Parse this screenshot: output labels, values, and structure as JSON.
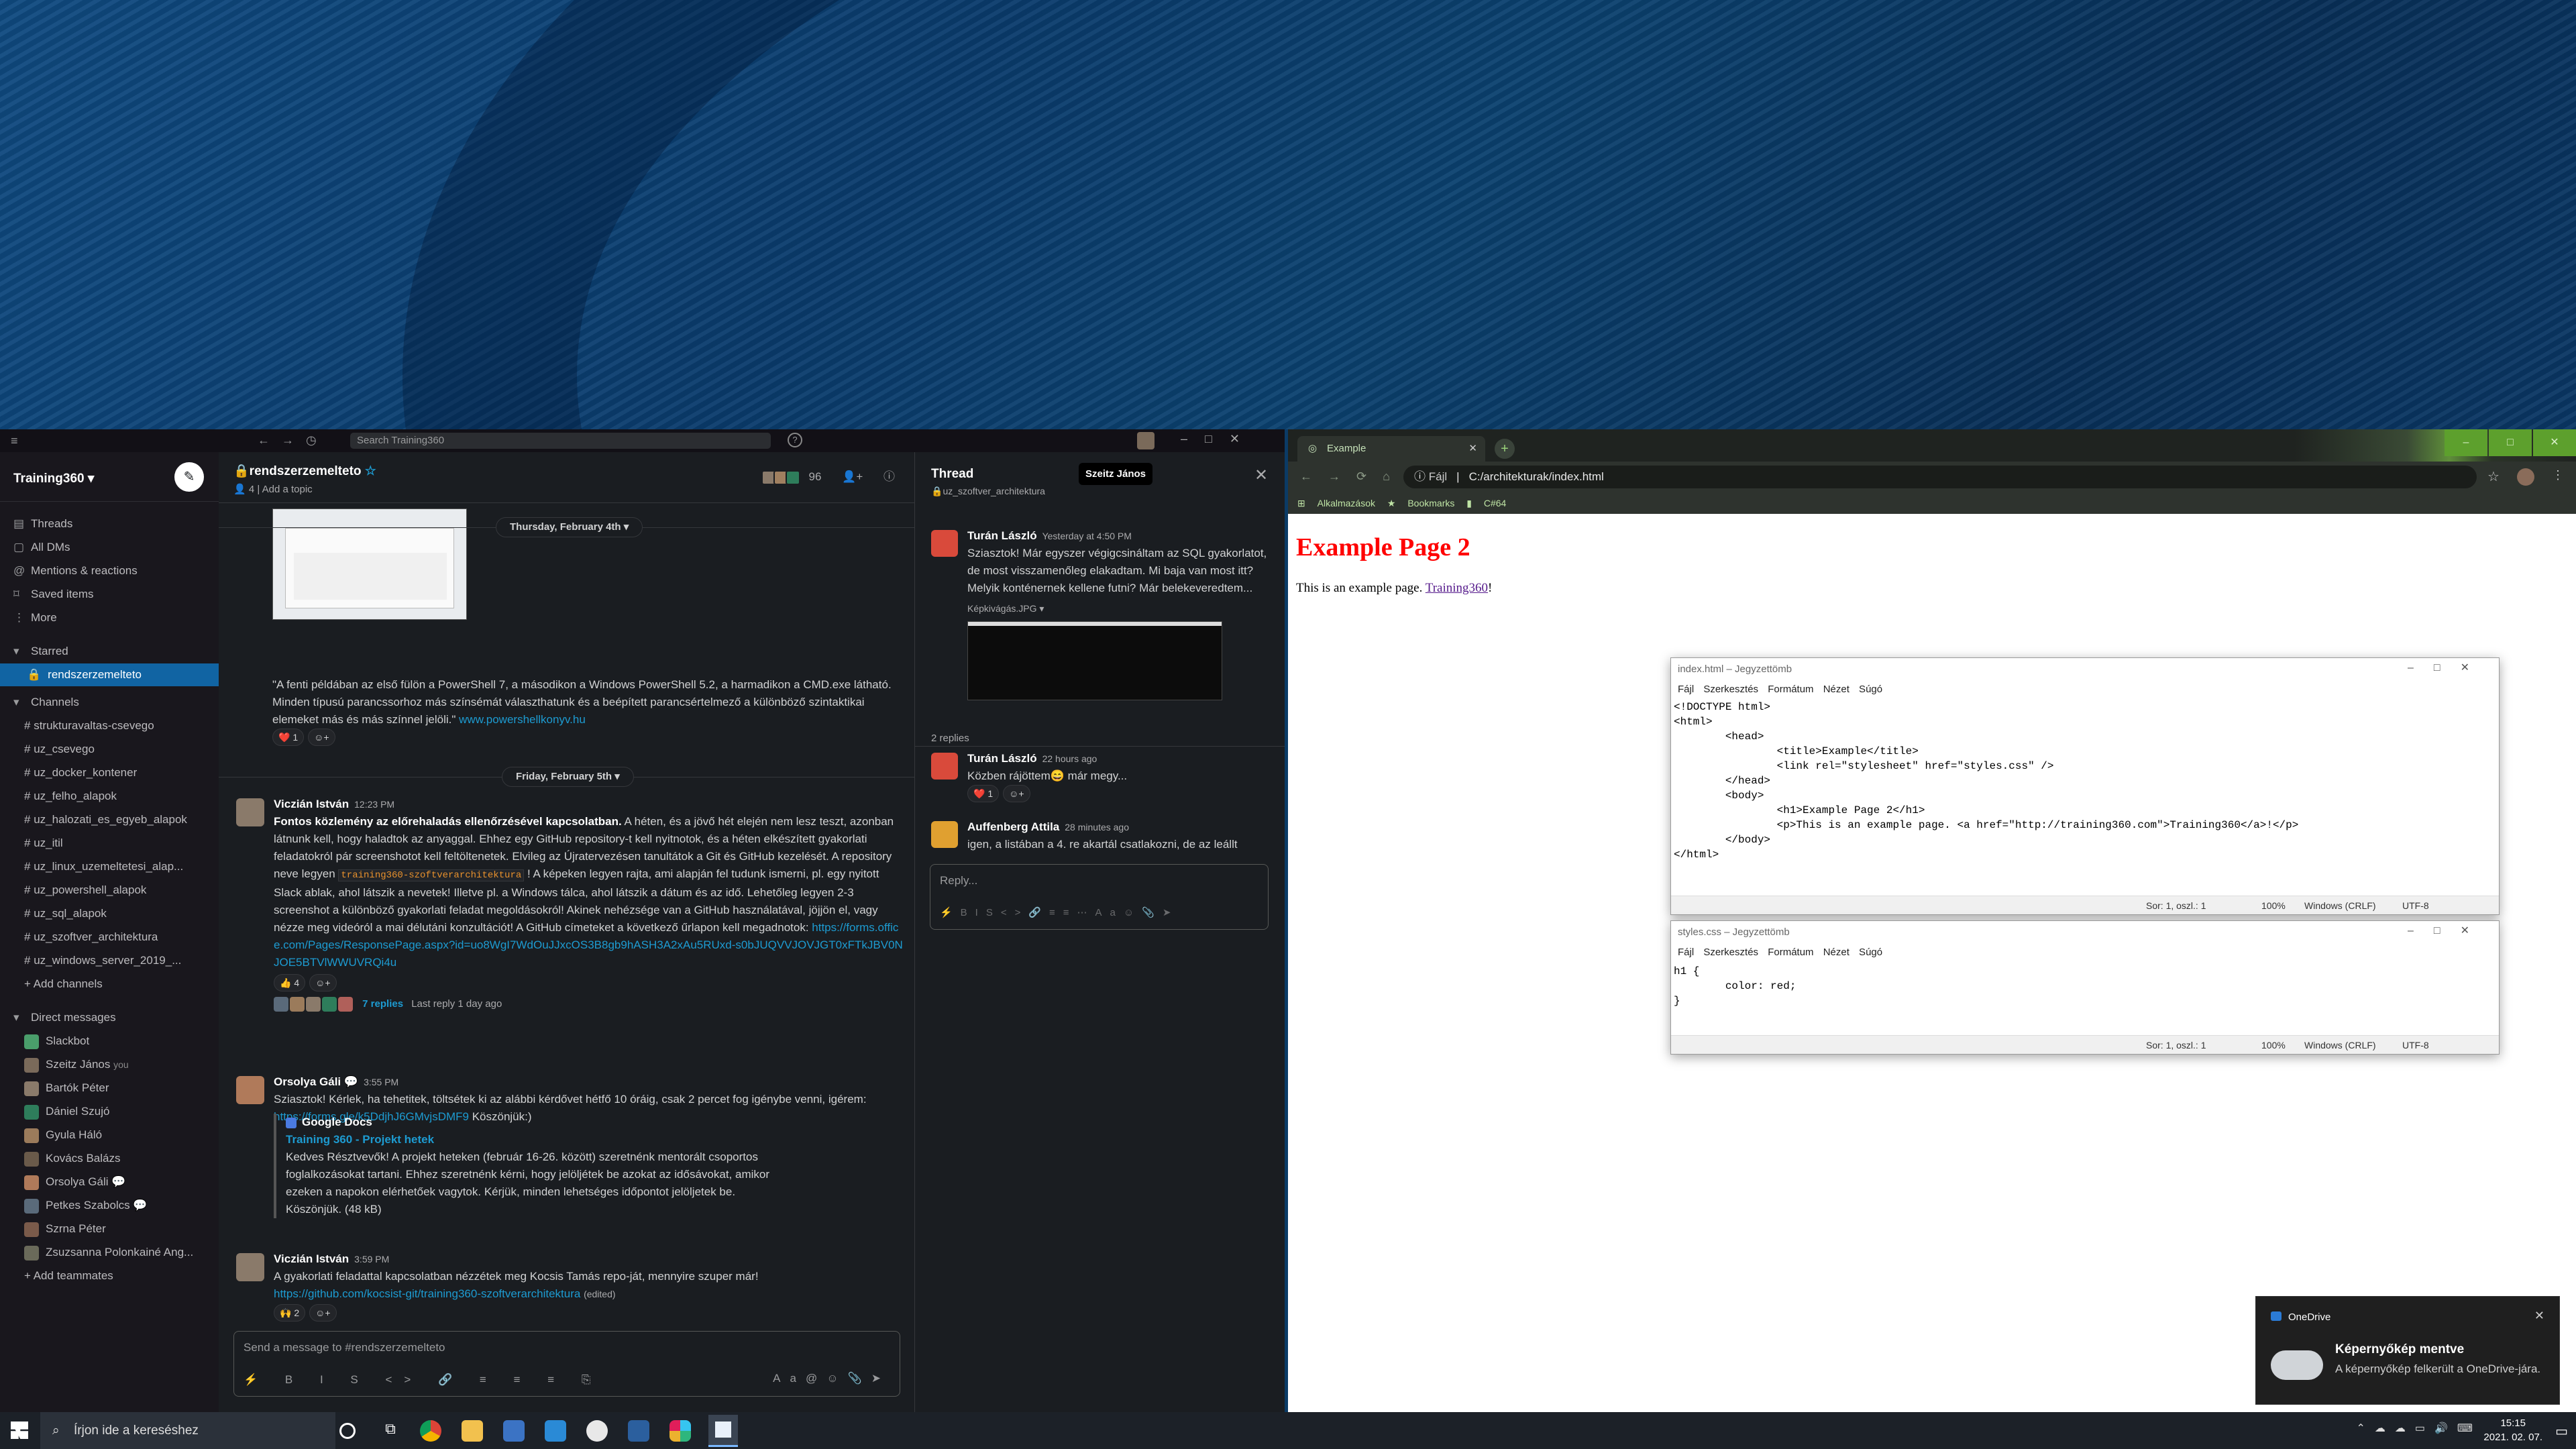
{
  "slack": {
    "search_placeholder": "Search Training360",
    "workspace": "Training360",
    "nav": [
      {
        "label": "Threads",
        "icon": "threads-icon"
      },
      {
        "label": "All DMs",
        "icon": "dm-icon"
      },
      {
        "label": "Mentions & reactions",
        "icon": "at-icon"
      },
      {
        "label": "Saved items",
        "icon": "bookmark-icon"
      },
      {
        "label": "More",
        "icon": "more-icon"
      }
    ],
    "starred_header": "Starred",
    "starred": [
      "rendszerzemelteto"
    ],
    "channels_header": "Channels",
    "channels": [
      "strukturavaltas-csevego",
      "uz_csevego",
      "uz_docker_kontener",
      "uz_felho_alapok",
      "uz_halozati_es_egyeb_alapok",
      "uz_itil",
      "uz_linux_uzemeltetesi_alap...",
      "uz_powershell_alapok",
      "uz_sql_alapok",
      "uz_szoftver_architektura",
      "uz_windows_server_2019_..."
    ],
    "add_channels": "Add channels",
    "dm_header": "Direct messages",
    "dms": [
      {
        "name": "Slackbot",
        "color": "#4a9e6b",
        "extra": ""
      },
      {
        "name": "Szeitz János",
        "color": "#7a6a5a",
        "extra": "you"
      },
      {
        "name": "Bartók Péter",
        "color": "#8a7a6a",
        "extra": ""
      },
      {
        "name": "Dániel Szujó",
        "color": "#2e7d5b",
        "extra": ""
      },
      {
        "name": "Gyula Háló",
        "color": "#9b7b5b",
        "extra": ""
      },
      {
        "name": "Kovács Balázs",
        "color": "#6a5a4a",
        "extra": ""
      },
      {
        "name": "Orsolya Gáli",
        "color": "#b07a5a",
        "extra": ""
      },
      {
        "name": "Petkes Szabolcs",
        "color": "#5a6a7a",
        "extra": ""
      },
      {
        "name": "Szrna Péter",
        "color": "#7a5a4a",
        "extra": ""
      },
      {
        "name": "Zsuzsanna Polonkainé Ang...",
        "color": "#6a6a5a",
        "extra": ""
      }
    ],
    "add_teammates": "Add teammates",
    "channel": {
      "name": "rendszerzemelteto",
      "members_icon": "members-icon",
      "member_count_small": "4",
      "add_topic": "Add a topic",
      "member_count": "96"
    },
    "dates": [
      "Thursday, February 4th",
      "Friday, February 5th"
    ],
    "caption": "\"A fenti példában az első fülön a PowerShell 7, a másodikon a Windows PowerShell 5.2, a harmadikon a CMD.exe látható. Minden típusú parancssorhoz más színsémát választhatunk és a beépített parancsértelmező a különböző szintaktikai elemeket más és más színnel jelöli.\"",
    "caption_link": "www.powershellkonyv.hu",
    "caption_reaction": "❤️ 1",
    "messages": [
      {
        "author": "Viczián István",
        "time": "12:23 PM",
        "bold": "Fontos közlemény az előrehaladás ellenőrzésével kapcsolatban.",
        "text1": " A héten, és a jövő hét elején nem lesz teszt, azonban látnunk kell, hogy haladtok az anyaggal. Ehhez egy GitHub repository-t kell nyitnotok, és a héten elkészített gyakorlati feladatokról pár screenshotot kell feltöltenetek. Elvileg az Újratervezésen tanultátok a Git és GitHub kezelését. A repository neve legyen ",
        "code": "training360-szoftverarchitektura",
        "text2": " ! A képeken legyen rajta, ami alapján fel tudunk ismerni, pl. egy nyitott Slack ablak, ahol látszik a nevetek! Illetve pl. a Windows tálca, ahol látszik a dátum és az idő. Lehetőleg legyen 2-3 screenshot a különböző gyakorlati feladat megoldásokról! Akinek nehézsége van a GitHub használatával, jöjjön el, vagy nézze meg videóról a mai délutáni konzultációt! A GitHub címeteket a következő űrlapon kell megadnotok: ",
        "link": "https://forms.office.com/Pages/ResponsePage.aspx?id=uo8WgI7WdOuJJxcOS3B8gb9hASH3A2xAu5RUxd-s0bJUQVVJOVJGT0xFTkJBV0NJOE5BTVlWWUVRQi4u",
        "reaction": "👍 4",
        "replies": "7 replies",
        "last_reply": "Last reply 1 day ago"
      },
      {
        "author": "Orsolya Gáli",
        "time": "3:55 PM",
        "text": "Sziasztok! Kérlek, ha tehetitek, töltsétek ki az alábbi kérdővet hétfő 10 óráig, csak 2 percet fog igénybe venni, igérem: ",
        "link": "https://forms.gle/k5DdjhJ6GMvjsDMF9",
        "text_end": " Köszönjük:)",
        "attach_source": "Google Docs",
        "attach_title": "Training 360 - Projekt hetek",
        "attach_body": "Kedves Résztvevők! A projekt heteken (február 16-26. között) szeretnénk mentorált csoportos foglalkozásokat tartani. Ehhez szeretnénk kérni, hogy jelöljétek be azokat az idősávokat, amikor ezeken a napokon elérhetőek vagytok. Kérjük, minden lehetséges időpontot jelöljetek be. Köszönjük. (48 kB)"
      },
      {
        "author": "Viczián István",
        "time": "3:59 PM",
        "text": "A gyakorlati feladattal kapcsolatban nézzétek meg Kocsis Tamás repo-ját, mennyire szuper már!",
        "link": "https://github.com/kocsist-git/training360-szoftverarchitektura",
        "edited": "(edited)",
        "reaction": "🙌 2"
      }
    ],
    "input_placeholder": "Send a message to #rendszerzemelteto",
    "thread": {
      "title": "Thread",
      "channel": "uz_szoftver_architektura",
      "tooltip": "Szeitz János",
      "parent_author": "Turán László",
      "parent_time": "Yesterday at 4:50 PM",
      "parent_text": "Sziasztok! Már egyszer végigcsináltam az SQL gyakorlatot, de most visszamenőleg elakadtam. Mi baja van most itt? Melyik konténernek kellene futni? Már belekeveredtem...",
      "file": "Képkivágás.JPG",
      "reply_count": "2 replies",
      "replies": [
        {
          "author": "Turán László",
          "time": "22 hours ago",
          "text": "Közben rájöttem😄 már megy...",
          "reaction": "❤️ 1",
          "color": "#d94a3b"
        },
        {
          "author": "Auffenberg Attila",
          "time": "28 minutes ago",
          "text": "igen, a listában a 4. re akartál csatlakozni, de az leállt",
          "color": "#e0a030"
        }
      ],
      "reply_placeholder": "Reply..."
    }
  },
  "chrome": {
    "tab_title": "Example",
    "url_label": "Fájl",
    "url": "C:/architekturak/index.html",
    "bookmarks": [
      "Alkalmazások",
      "Bookmarks",
      "C#64"
    ],
    "page": {
      "h1": "Example Page 2",
      "p_before": "This is an example page. ",
      "p_link": "Training360",
      "p_after": "!"
    }
  },
  "notepad1": {
    "title": "index.html – Jegyzettömb",
    "menu": "Fájl Szerkesztés Formátum Nézet Súgó",
    "content": "<!DOCTYPE html>\n<html>\n        <head>\n                <title>Example</title>\n                <link rel=\"stylesheet\" href=\"styles.css\" />\n        </head>\n        <body>\n                <h1>Example Page 2</h1>\n                <p>This is an example page. <a href=\"http://training360.com\">Training360</a>!</p>\n        </body>\n</html>",
    "pos": "Sor: 1, oszl.: 1",
    "zoom": "100%",
    "eol": "Windows (CRLF)",
    "enc": "UTF-8"
  },
  "notepad2": {
    "title": "styles.css – Jegyzettömb",
    "menu": "Fájl Szerkesztés Formátum Nézet Súgó",
    "content": "h1 {\n        color: red;\n}",
    "pos": "Sor: 1, oszl.: 1",
    "zoom": "100%",
    "eol": "Windows (CRLF)",
    "enc": "UTF-8"
  },
  "toast": {
    "app": "OneDrive",
    "title": "Képernyőkép mentve",
    "body": "A képernyőkép felkerült a OneDrive-jára."
  },
  "taskbar": {
    "search": "Írjon ide a kereséshez",
    "time": "15:15",
    "date": "2021. 02. 07."
  }
}
